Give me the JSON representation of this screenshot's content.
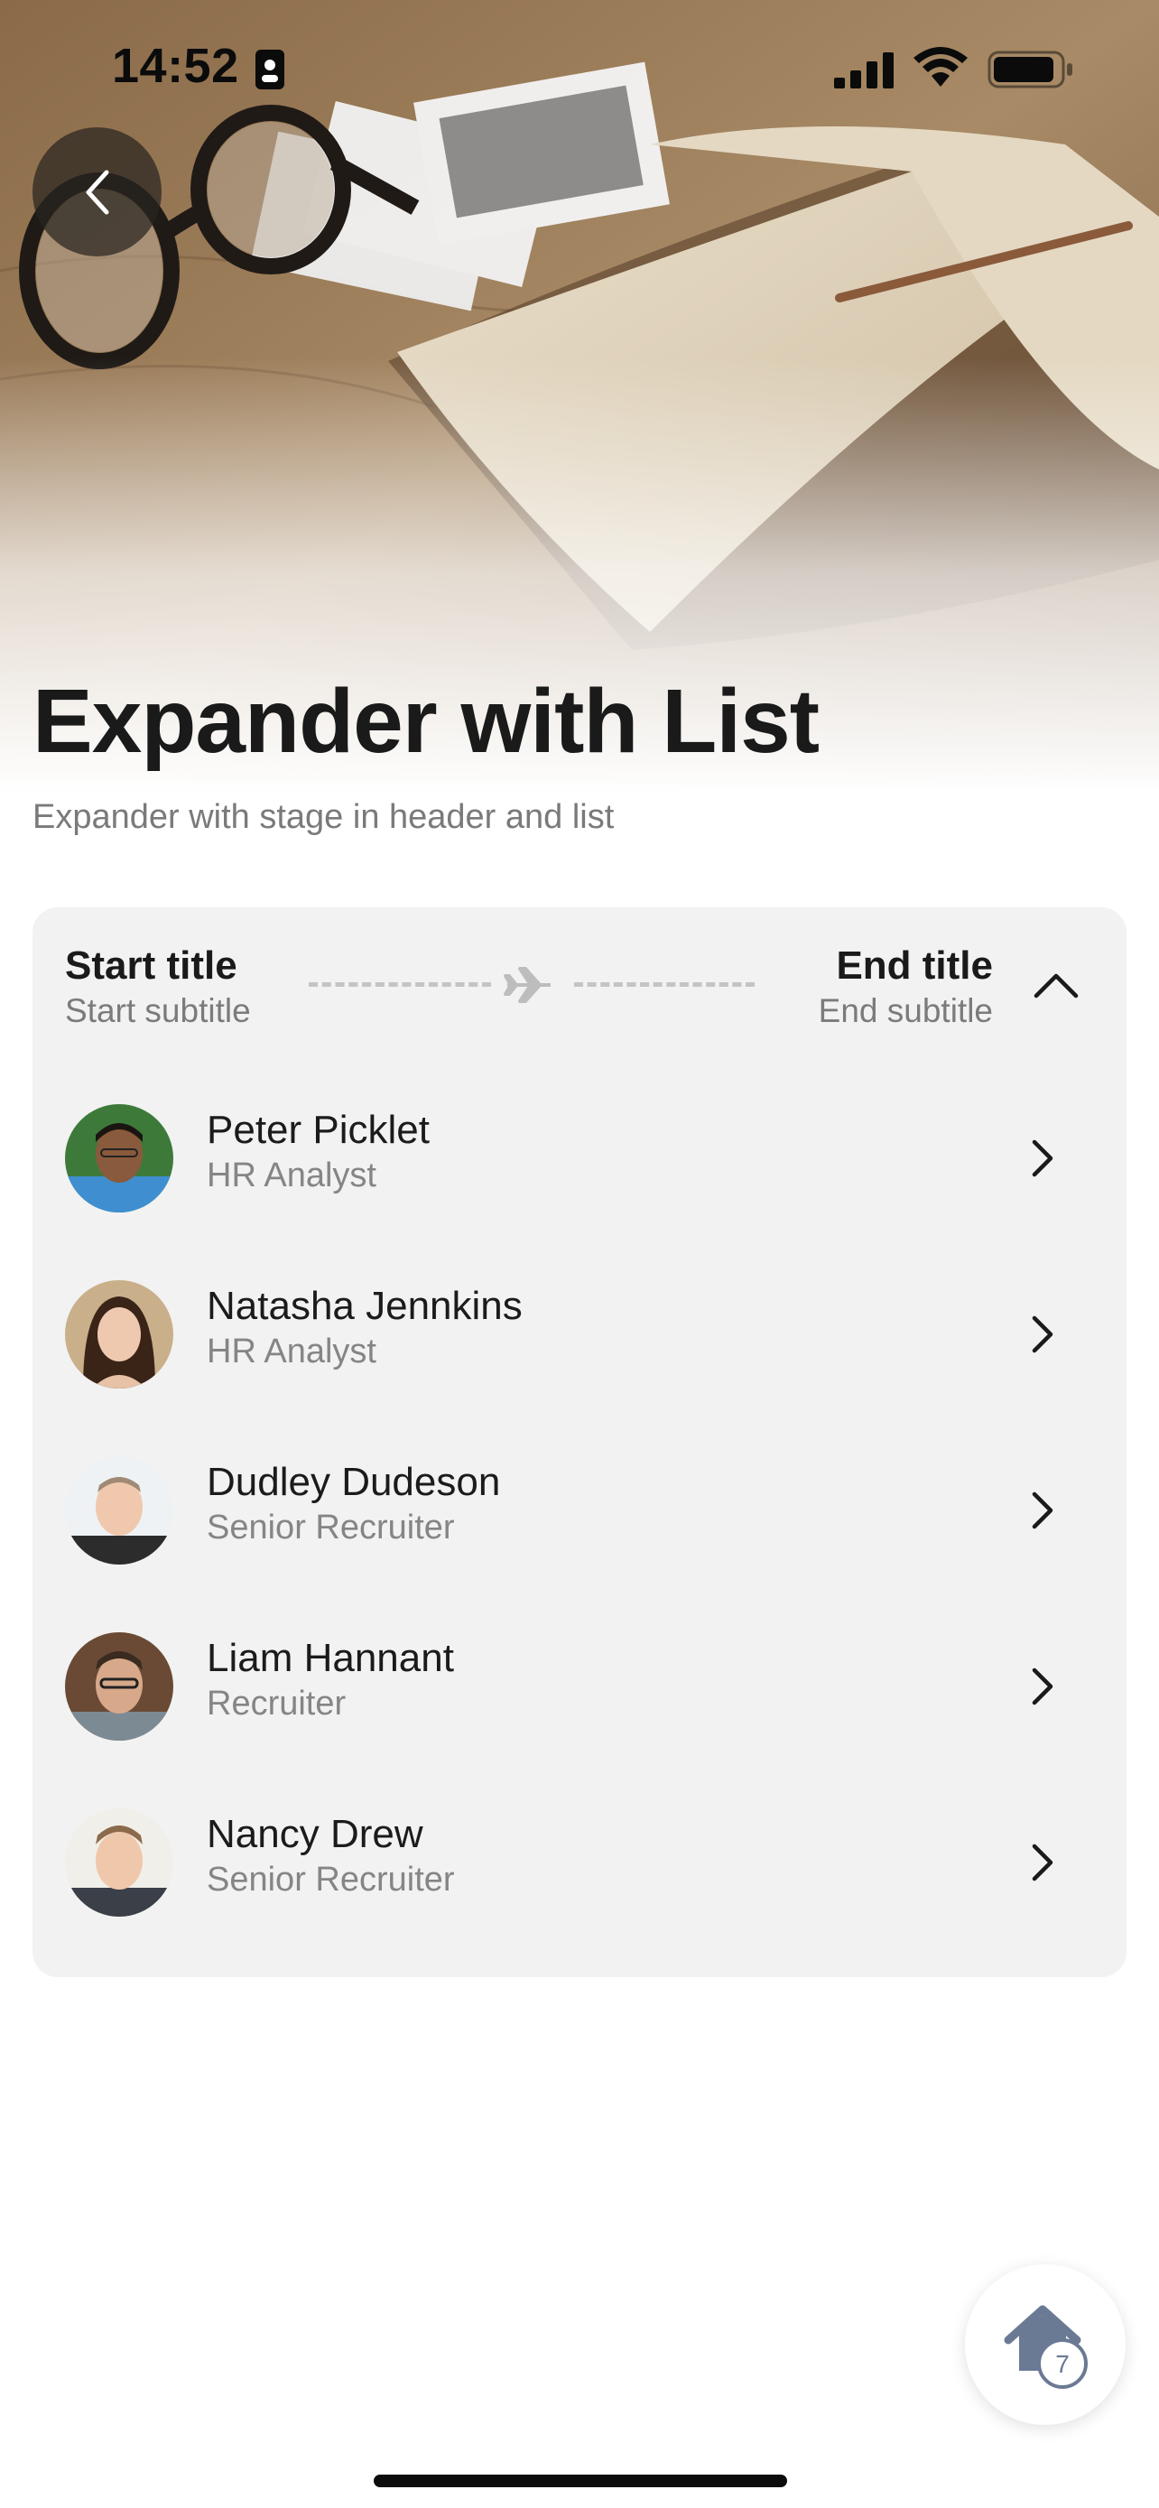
{
  "status_bar": {
    "time": "14:52"
  },
  "header": {
    "title": "Expander with List",
    "subtitle": "Expander with stage in header and list"
  },
  "stage": {
    "start_title": "Start title",
    "start_subtitle": "Start subtitle",
    "end_title": "End title",
    "end_subtitle": "End subtitle"
  },
  "people": [
    {
      "name": "Peter Picklet",
      "role": "HR Analyst"
    },
    {
      "name": "Natasha Jennkins",
      "role": "HR Analyst"
    },
    {
      "name": "Dudley Dudeson",
      "role": "Senior Recruiter"
    },
    {
      "name": "Liam Hannant",
      "role": "Recruiter"
    },
    {
      "name": "Nancy Drew",
      "role": "Senior Recruiter"
    }
  ],
  "fab": {
    "badge": "7",
    "icon": "home-icon"
  },
  "colors": {
    "card_bg": "#f2f2f2",
    "subtitle_gray": "#7a7a7a",
    "fab_icon": "#6b7a94"
  }
}
